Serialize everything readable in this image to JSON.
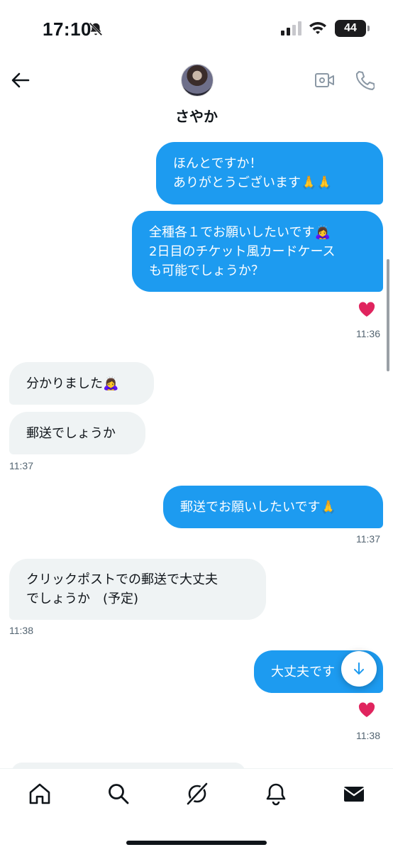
{
  "status_bar": {
    "time": "17:10",
    "battery": "44"
  },
  "header": {
    "contact_name": "さやか"
  },
  "messages": [
    {
      "direction": "sent",
      "lines": [
        "ほんとですか！",
        "ありがとうございます🙏🙏"
      ]
    },
    {
      "direction": "sent",
      "lines": [
        "全種各１でお願いしたいです🙇‍♀️",
        "2日目のチケット風カードケース",
        "も可能でしょうか？"
      ],
      "reaction": "❤️",
      "time": "11:36"
    },
    {
      "direction": "received",
      "lines": [
        "分かりました🙇‍♀️"
      ]
    },
    {
      "direction": "received",
      "lines": [
        "郵送でしょうか"
      ],
      "time": "11:37"
    },
    {
      "direction": "sent",
      "lines": [
        "郵送でお願いしたいです🙏"
      ],
      "time": "11:37"
    },
    {
      "direction": "received",
      "lines": [
        "クリックポストでの郵送で大丈夫",
        "でしょうか　(予定)"
      ],
      "time": "11:38"
    },
    {
      "direction": "sent",
      "lines": [
        "大丈夫です"
      ],
      "reaction": "❤️",
      "time": "11:38"
    }
  ],
  "icons": {
    "back": "arrow-left-icon",
    "video": "video-call-icon",
    "phone": "phone-icon",
    "scroll_down": "arrow-down-icon",
    "tabs": [
      "home-icon",
      "search-icon",
      "grok-icon",
      "bell-icon",
      "mail-icon"
    ]
  },
  "colors": {
    "sent_bubble": "#1d9bf0",
    "received_bubble": "#eff3f4",
    "heart": "#e0245e"
  }
}
